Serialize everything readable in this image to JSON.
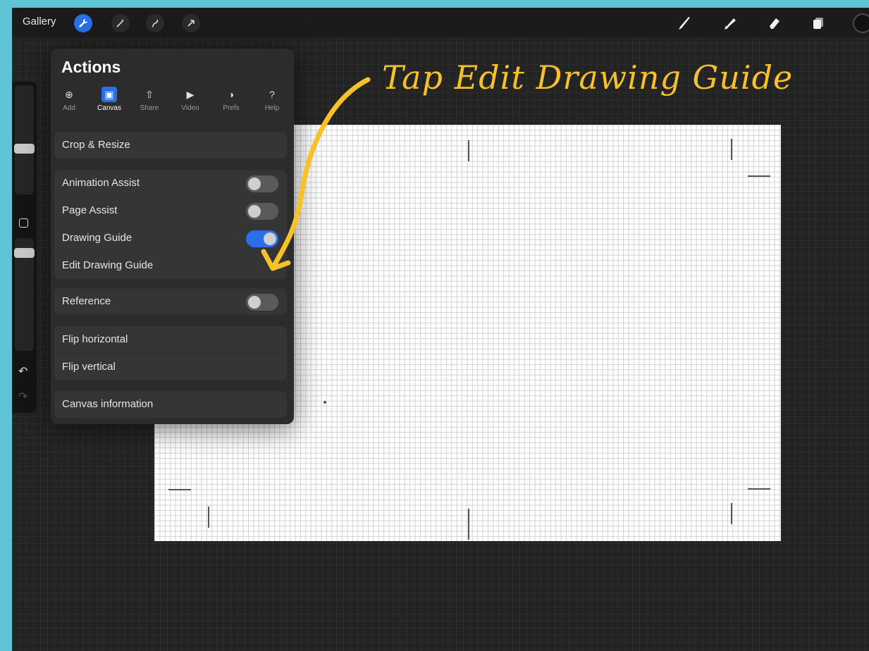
{
  "topbar": {
    "gallery_label": "Gallery",
    "left_tools": [
      "wrench-icon",
      "magic-wand-icon",
      "selection-icon",
      "move-icon"
    ],
    "right_tools": [
      "brush-icon",
      "smudge-icon",
      "eraser-icon",
      "layers-icon",
      "color-icon"
    ],
    "accent_color": "#2a6ee8"
  },
  "actions": {
    "title": "Actions",
    "tabs": [
      {
        "label": "Add",
        "icon": "add-icon"
      },
      {
        "label": "Canvas",
        "icon": "canvas-icon",
        "selected": true
      },
      {
        "label": "Share",
        "icon": "share-icon"
      },
      {
        "label": "Video",
        "icon": "video-icon"
      },
      {
        "label": "Prefs",
        "icon": "prefs-icon"
      },
      {
        "label": "Help",
        "icon": "help-icon"
      }
    ],
    "rows": {
      "crop_resize": "Crop & Resize",
      "animation_assist": "Animation Assist",
      "page_assist": "Page Assist",
      "drawing_guide": "Drawing Guide",
      "edit_drawing_guide": "Edit Drawing Guide",
      "reference": "Reference",
      "flip_horizontal": "Flip horizontal",
      "flip_vertical": "Flip vertical",
      "canvas_information": "Canvas information"
    },
    "toggles": {
      "animation_assist": false,
      "page_assist": false,
      "drawing_guide": true,
      "reference": false
    }
  },
  "annotation": {
    "text": "Tap Edit Drawing Guide",
    "color": "#f7c12a"
  }
}
